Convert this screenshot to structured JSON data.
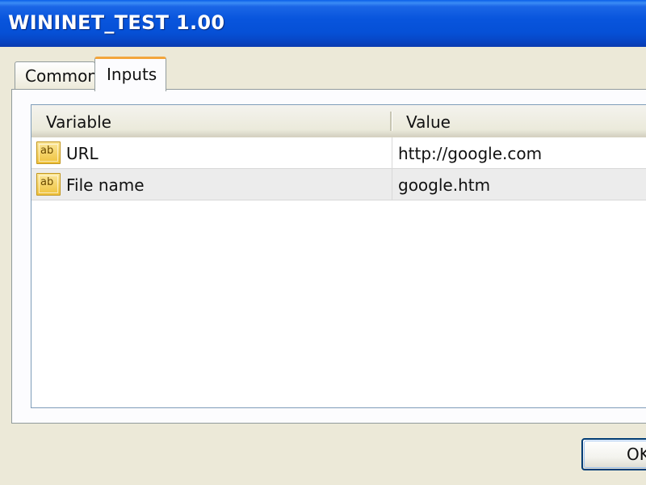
{
  "window": {
    "title": "WININET_TEST 1.00"
  },
  "tabs": [
    {
      "label": "Common",
      "selected": false
    },
    {
      "label": "Inputs",
      "selected": true
    }
  ],
  "table": {
    "columns": [
      "Variable",
      "Value"
    ],
    "rows": [
      {
        "icon": "ab-string-icon",
        "icon_text": "ab",
        "variable": "URL",
        "value": "http://google.com"
      },
      {
        "icon": "ab-string-icon",
        "icon_text": "ab",
        "variable": "File name",
        "value": "google.htm"
      }
    ]
  },
  "buttons": {
    "ok_label": "OK"
  },
  "colors": {
    "titlebar": "#0855dd",
    "selected_tab_accent": "#f3a53b",
    "window_bg": "#ece9d8"
  }
}
